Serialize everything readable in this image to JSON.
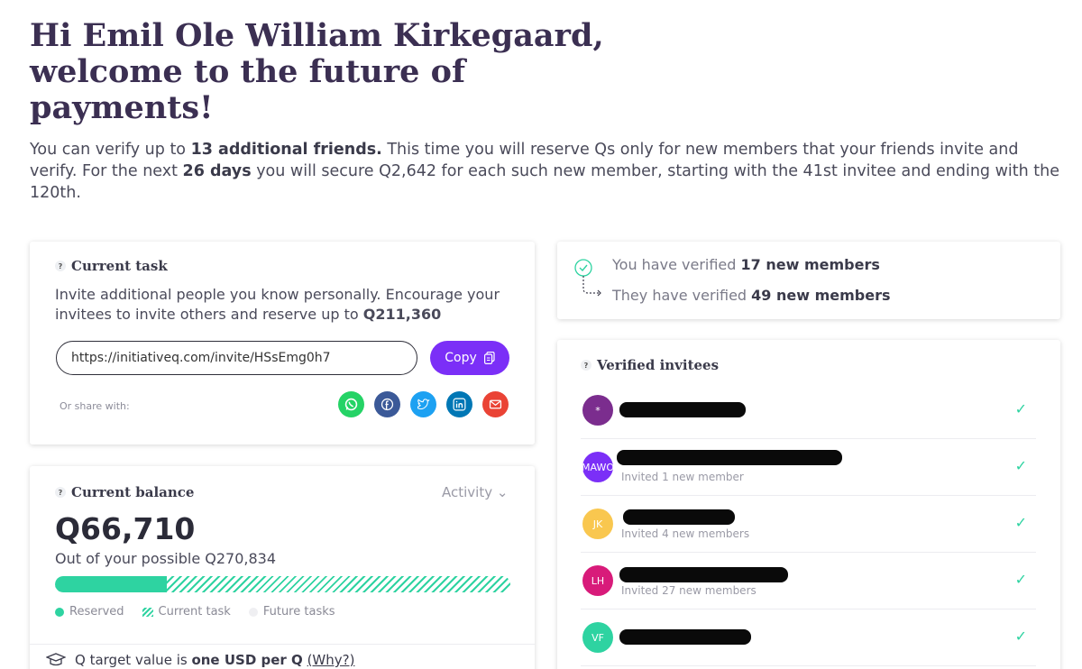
{
  "header": {
    "title": "Hi Emil Ole William Kirkegaard, welcome to the future of payments!",
    "intro_p1": "You can verify up to ",
    "intro_b1": "13 additional friends.",
    "intro_p2": " This time you will reserve Qs only for new members that your friends invite and verify. For the next ",
    "intro_b2": "26 days",
    "intro_p3": " you will secure Q2,642 for each such new member, starting with the 41st invitee and ending with the 120th."
  },
  "task": {
    "title": "Current task",
    "desc": "Invite additional people you know personally. Encourage your invitees to invite others and reserve up to ",
    "desc_amount": "Q211,360",
    "invite_url": "https://initiativeq.com/invite/HSsEmg0h7",
    "copy_label": "Copy",
    "share_label": "Or share with:",
    "share_icons": [
      "whatsapp-icon",
      "facebook-icon",
      "twitter-icon",
      "linkedin-icon",
      "email-icon"
    ]
  },
  "balance": {
    "title": "Current balance",
    "activity_label": "Activity",
    "amount": "Q66,710",
    "out_of": "Out of your possible Q270,834",
    "reserved_fraction": 0.246,
    "legend": {
      "reserved": "Reserved",
      "current": "Current task",
      "future": "Future tasks"
    },
    "target_pre": "Q target value is ",
    "target_b": "one USD per Q",
    "target_why": "(Why?)"
  },
  "summary": {
    "line1_pre": "You have verified ",
    "line1_b": "17 new members",
    "line2_pre": "They have verified ",
    "line2_b": "49 new members"
  },
  "invitees": {
    "title": "Verified invitees",
    "rows": [
      {
        "initials": "*",
        "color": "#7b2d8e",
        "sub": ""
      },
      {
        "initials": "MAWO",
        "color": "#7b2ff7",
        "sub": "Invited 1 new member"
      },
      {
        "initials": "JK",
        "color": "#f9c74f",
        "sub": "Invited 4 new members"
      },
      {
        "initials": "LH",
        "color": "#d81b7a",
        "sub": "Invited 27 new members"
      },
      {
        "initials": "VF",
        "color": "#2ed3a1",
        "sub": ""
      }
    ]
  },
  "colors": {
    "accent": "#7b2ff7",
    "green": "#2ed3a1",
    "title": "#3b2f52"
  }
}
